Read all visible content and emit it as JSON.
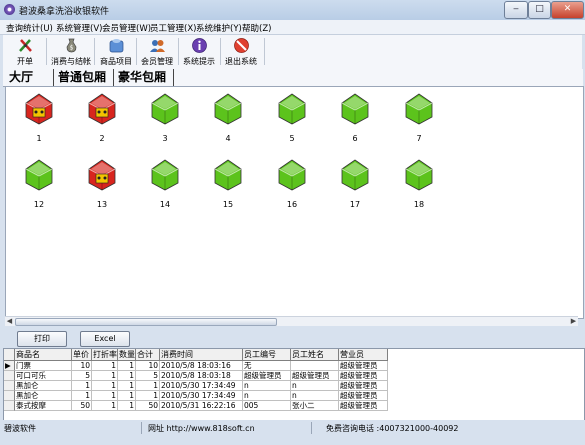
{
  "window": {
    "title": "碧波桑拿洗浴收银软件",
    "controls": {
      "minimize": "‒",
      "maximize": "□",
      "close": "✕"
    }
  },
  "menu": [
    "查询统计(U)",
    "系统管理(V)",
    "会员管理(W)",
    "员工管理(X)",
    "系统维护(Y)",
    "帮助(Z)"
  ],
  "toolbar": [
    {
      "label": "开单",
      "icon": "open-order-icon"
    },
    {
      "label": "消费与结帐",
      "icon": "checkout-icon"
    },
    {
      "label": "商品项目",
      "icon": "products-icon"
    },
    {
      "label": "会员管理",
      "icon": "members-icon"
    },
    {
      "label": "系统提示",
      "icon": "system-tips-icon"
    },
    {
      "label": "退出系统",
      "icon": "exit-icon"
    }
  ],
  "tabs": [
    "大厅",
    "普通包厢",
    "豪华包厢"
  ],
  "rooms": [
    {
      "number": "1",
      "status": "occupied"
    },
    {
      "number": "2",
      "status": "occupied"
    },
    {
      "number": "3",
      "status": "free"
    },
    {
      "number": "4",
      "status": "free"
    },
    {
      "number": "5",
      "status": "free"
    },
    {
      "number": "6",
      "status": "free"
    },
    {
      "number": "7",
      "status": "free"
    },
    {
      "number": "12",
      "status": "free"
    },
    {
      "number": "13",
      "status": "occupied"
    },
    {
      "number": "14",
      "status": "free"
    },
    {
      "number": "15",
      "status": "free"
    },
    {
      "number": "16",
      "status": "free"
    },
    {
      "number": "17",
      "status": "free"
    },
    {
      "number": "18",
      "status": "free"
    }
  ],
  "actions": {
    "print": "打印",
    "excel": "Excel"
  },
  "table": {
    "columns": [
      "商品名",
      "单价",
      "打折率",
      "数量",
      "合计",
      "消费时间",
      "员工编号",
      "员工姓名",
      "营业员"
    ],
    "rows": [
      [
        "门票",
        "10",
        "1",
        "1",
        "10",
        "2010/5/8 18:03:16",
        "无",
        "",
        "超级管理员"
      ],
      [
        "可口可乐",
        "5",
        "1",
        "1",
        "5",
        "2010/5/8 18:03:18",
        "超级管理员",
        "超级管理员",
        "超级管理员"
      ],
      [
        "黑加仑",
        "1",
        "1",
        "1",
        "1",
        "2010/5/30 17:34:49",
        "n",
        "n",
        "超级管理员"
      ],
      [
        "黑加仑",
        "1",
        "1",
        "1",
        "1",
        "2010/5/30 17:34:49",
        "n",
        "n",
        "超级管理员"
      ],
      [
        "泰式按摩",
        "50",
        "1",
        "1",
        "50",
        "2010/5/31 16:22:16",
        "005",
        "张小二",
        "超级管理员"
      ]
    ],
    "current_row_marker": "▶"
  },
  "status": {
    "app": "碧波软件",
    "website": "网址 http://www.818soft.cn",
    "hotline": "免费咨询电话 :4007321000-40092"
  },
  "colors": {
    "occupied": "#d8251e",
    "free": "#5cc31c",
    "titlebar": "#c3d4ea"
  }
}
